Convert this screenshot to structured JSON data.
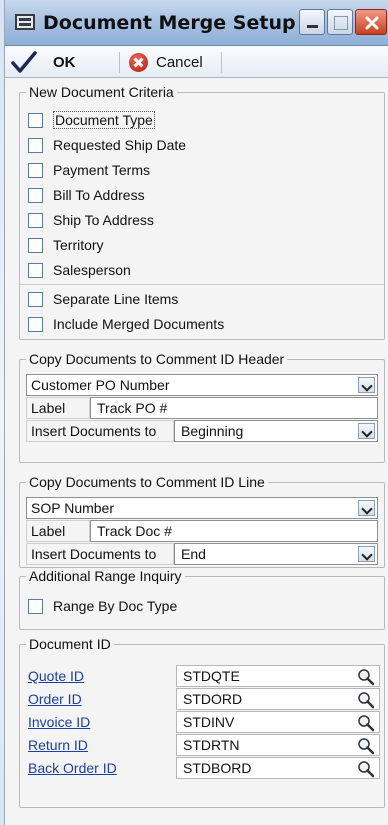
{
  "window": {
    "title": "Document Merge Setup"
  },
  "toolbar": {
    "ok_label": "OK",
    "cancel_label": "Cancel"
  },
  "criteria": {
    "legend": "New Document Criteria",
    "items": [
      {
        "label": "Document Type",
        "checked": false
      },
      {
        "label": "Requested Ship Date",
        "checked": false
      },
      {
        "label": "Payment Terms",
        "checked": false
      },
      {
        "label": "Bill To Address",
        "checked": false
      },
      {
        "label": "Ship To Address",
        "checked": false
      },
      {
        "label": "Territory",
        "checked": false
      },
      {
        "label": "Salesperson",
        "checked": false
      }
    ],
    "separate_line_items": "Separate Line Items",
    "include_merged": "Include Merged Documents"
  },
  "header_copy": {
    "legend": "Copy Documents to Comment ID Header",
    "field_value": "Customer PO Number",
    "label_label": "Label",
    "label_value": "Track PO #",
    "insert_label": "Insert Documents to",
    "insert_value": "Beginning"
  },
  "line_copy": {
    "legend": "Copy Documents to Comment ID Line",
    "field_value": "SOP Number",
    "label_label": "Label",
    "label_value": "Track Doc #",
    "insert_label": "Insert Documents to",
    "insert_value": "End"
  },
  "range_inquiry": {
    "legend": "Additional Range Inquiry",
    "option": "Range By Doc Type"
  },
  "document_id": {
    "legend": "Document ID",
    "rows": [
      {
        "label": "Quote ID",
        "value": "STDQTE"
      },
      {
        "label": "Order ID",
        "value": "STDORD"
      },
      {
        "label": "Invoice ID",
        "value": "STDINV"
      },
      {
        "label": "Return ID",
        "value": "STDRTN"
      },
      {
        "label": "Back Order ID",
        "value": "STDBORD"
      }
    ]
  }
}
